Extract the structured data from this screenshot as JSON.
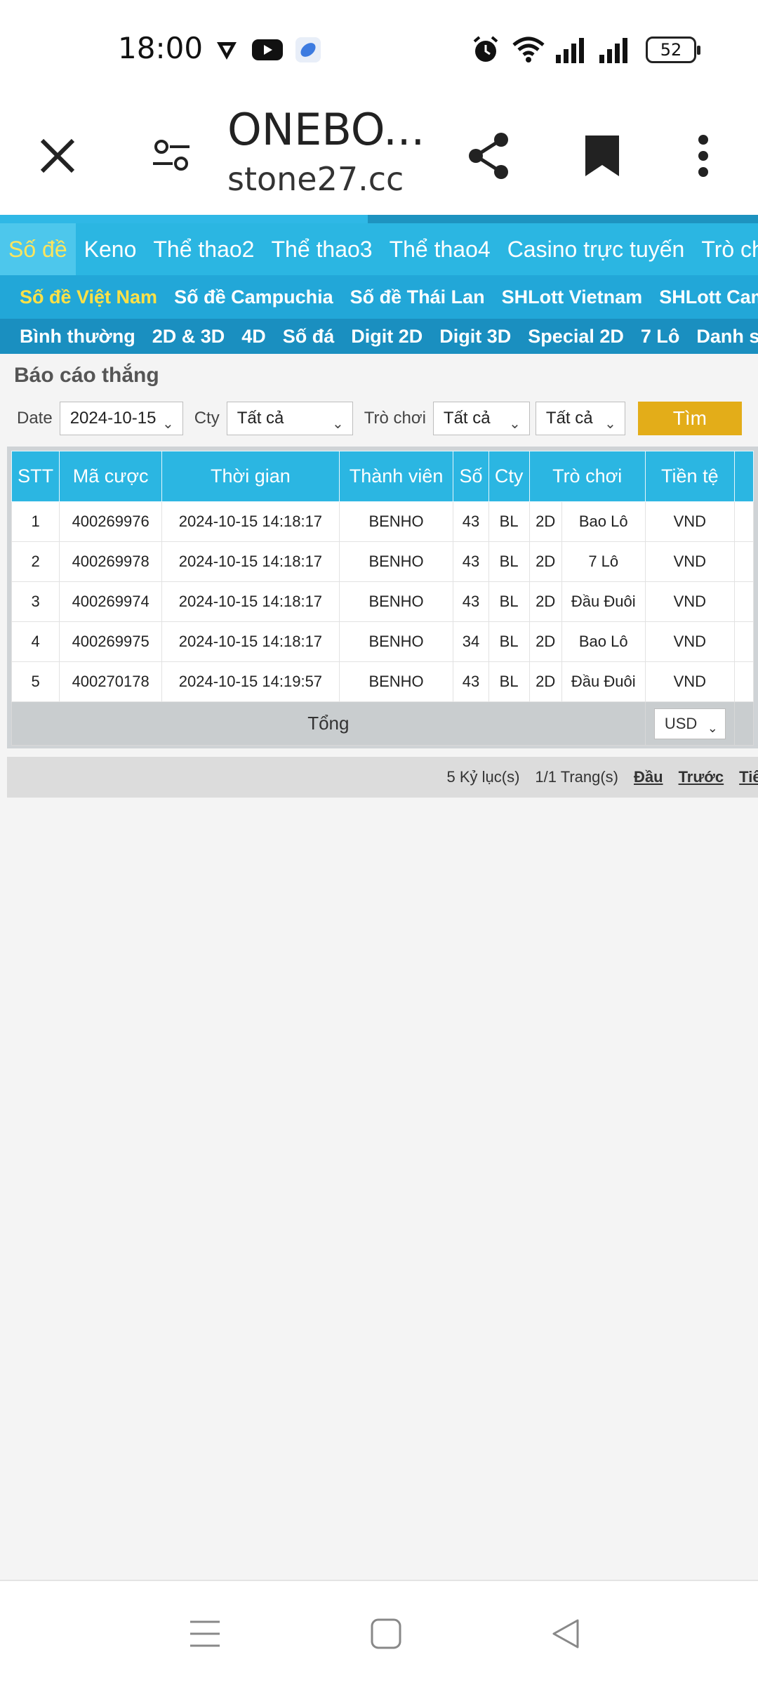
{
  "status_bar": {
    "time": "18:00",
    "battery": "52",
    "icons": [
      "vpn-shield-icon",
      "youtube-icon",
      "app-icon",
      "alarm-icon",
      "wifi-icon",
      "signal-icon",
      "signal-icon"
    ]
  },
  "browser": {
    "title": "ONEBO...",
    "url": "stone27.cc",
    "icons": [
      "close-icon",
      "site-settings-icon",
      "share-icon",
      "bookmark-icon",
      "more-vert-icon"
    ]
  },
  "nav_main": [
    {
      "label": "Số đề",
      "active": true
    },
    {
      "label": "Keno"
    },
    {
      "label": "Thể thao2"
    },
    {
      "label": "Thể thao3"
    },
    {
      "label": "Thể thao4"
    },
    {
      "label": "Casino trực tuyến"
    },
    {
      "label": "Trò cho"
    }
  ],
  "nav_sub": [
    {
      "label": "Số đề Việt Nam",
      "active": true
    },
    {
      "label": "Số đề Campuchia"
    },
    {
      "label": "Số đề Thái Lan"
    },
    {
      "label": "SHLott Vietnam"
    },
    {
      "label": "SHLott Camb"
    }
  ],
  "nav_type": [
    {
      "label": "Bình thường"
    },
    {
      "label": "2D & 3D"
    },
    {
      "label": "4D"
    },
    {
      "label": "Số đá"
    },
    {
      "label": "Digit 2D"
    },
    {
      "label": "Digit 3D"
    },
    {
      "label": "Special 2D"
    },
    {
      "label": "7 Lô"
    },
    {
      "label": "Danh sách"
    }
  ],
  "report": {
    "title": "Báo cáo thắng",
    "filters": {
      "date_label": "Date",
      "date_value": "2024-10-15",
      "cty_label": "Cty",
      "cty_value": "Tất cả",
      "game_label": "Trò chơi",
      "game_value": "Tất cả",
      "extra_value": "Tất cả",
      "search_label": "Tìm"
    },
    "columns": [
      "STT",
      "Mã cược",
      "Thời gian",
      "Thành viên",
      "Số",
      "Cty",
      "Trò chơi",
      "Tiền tệ"
    ],
    "rows": [
      {
        "stt": "1",
        "code": "400269976",
        "time": "2024-10-15 14:18:17",
        "member": "BENHO",
        "number": "43",
        "cty": "BL",
        "game_type": "2D",
        "game": "Bao Lô",
        "currency": "VND"
      },
      {
        "stt": "2",
        "code": "400269978",
        "time": "2024-10-15 14:18:17",
        "member": "BENHO",
        "number": "43",
        "cty": "BL",
        "game_type": "2D",
        "game": "7 Lô",
        "currency": "VND"
      },
      {
        "stt": "3",
        "code": "400269974",
        "time": "2024-10-15 14:18:17",
        "member": "BENHO",
        "number": "43",
        "cty": "BL",
        "game_type": "2D",
        "game": "Đầu Đuôi",
        "currency": "VND"
      },
      {
        "stt": "4",
        "code": "400269975",
        "time": "2024-10-15 14:18:17",
        "member": "BENHO",
        "number": "34",
        "cty": "BL",
        "game_type": "2D",
        "game": "Bao Lô",
        "currency": "VND"
      },
      {
        "stt": "5",
        "code": "400270178",
        "time": "2024-10-15 14:19:57",
        "member": "BENHO",
        "number": "43",
        "cty": "BL",
        "game_type": "2D",
        "game": "Đầu Đuôi",
        "currency": "VND"
      }
    ],
    "total_label": "Tổng",
    "total_currency": "USD",
    "pager": {
      "records": "5 Kỷ lục(s)",
      "pages": "1/1 Trang(s)",
      "first": "Đầu",
      "prev": "Trước",
      "next": "Tiếp"
    }
  },
  "colors": {
    "nav_main": "#2bb6e2",
    "nav_active_text": "#ffe55c",
    "search_button": "#e3ad19",
    "table_header": "#2bb6e2"
  },
  "system_nav_icons": [
    "menu-icon",
    "home-icon",
    "back-icon"
  ]
}
